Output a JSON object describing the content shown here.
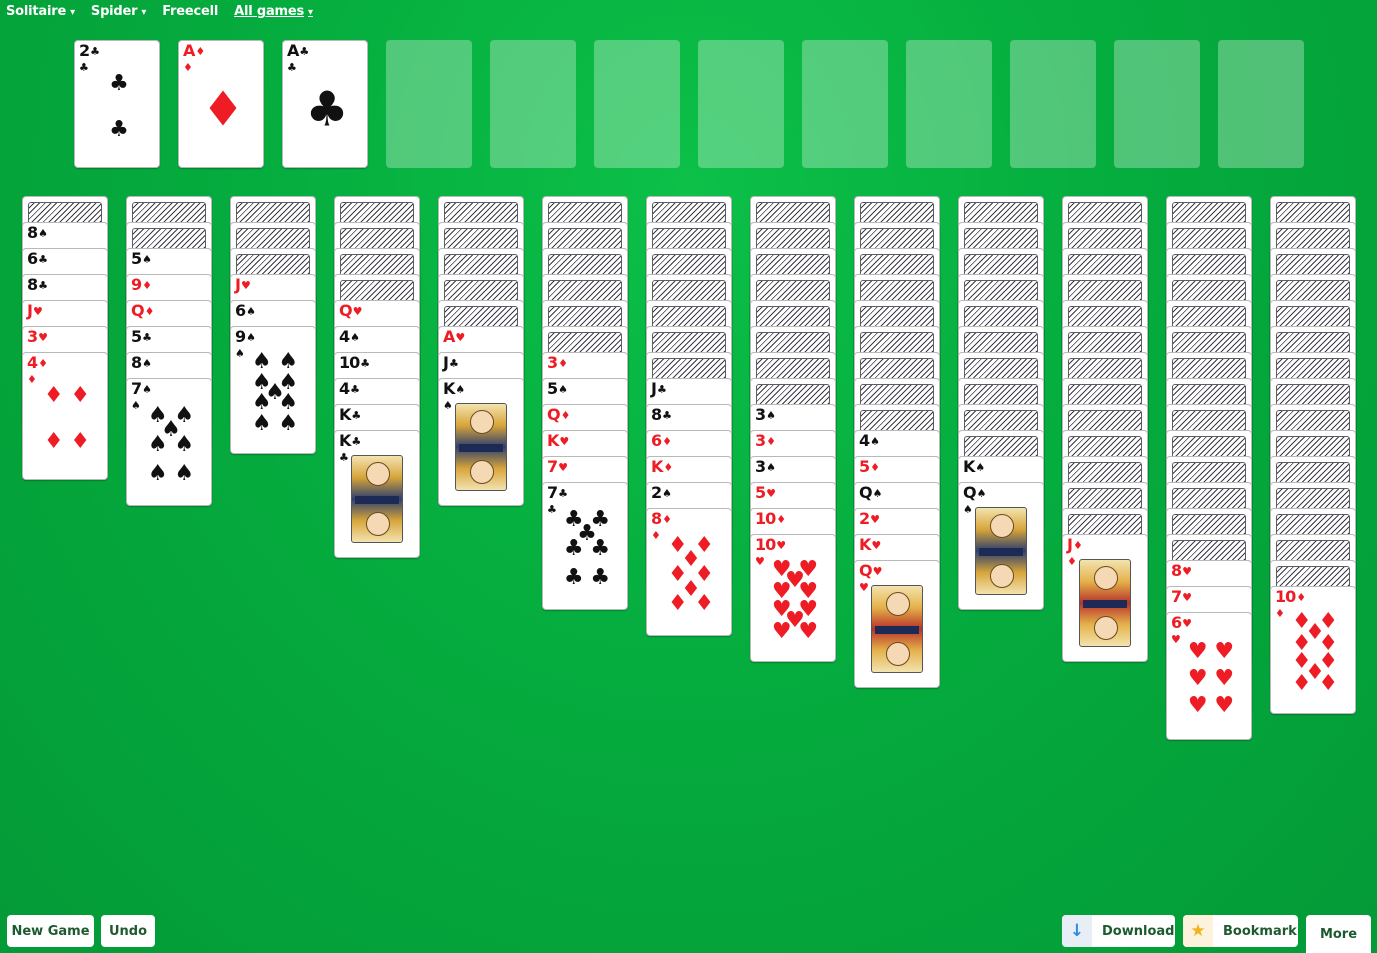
{
  "nav": [
    {
      "label": "Solitaire",
      "caret": "▾"
    },
    {
      "label": "Spider",
      "caret": "▾"
    },
    {
      "label": "Freecell",
      "caret": ""
    },
    {
      "label": "All games",
      "caret": "▾",
      "underline": true
    }
  ],
  "foundations": [
    {
      "rank": "2",
      "suit": "♣",
      "color": "black"
    },
    {
      "rank": "A",
      "suit": "♦",
      "color": "red"
    },
    {
      "rank": "A",
      "suit": "♣",
      "color": "black"
    },
    null,
    null,
    null,
    null,
    null,
    null,
    null,
    null,
    null
  ],
  "columns": [
    {
      "hidden": 1,
      "up": [
        [
          "8",
          "♠"
        ],
        [
          "6",
          "♣"
        ],
        [
          "8",
          "♣"
        ],
        [
          "J",
          "♥"
        ],
        [
          "3",
          "♥"
        ],
        [
          "4",
          "♦"
        ]
      ]
    },
    {
      "hidden": 2,
      "up": [
        [
          "5",
          "♠"
        ],
        [
          "9",
          "♦"
        ],
        [
          "Q",
          "♦"
        ],
        [
          "5",
          "♣"
        ],
        [
          "8",
          "♠"
        ],
        [
          "7",
          "♠"
        ]
      ]
    },
    {
      "hidden": 3,
      "up": [
        [
          "J",
          "♥"
        ],
        [
          "6",
          "♠"
        ],
        [
          "9",
          "♠"
        ]
      ]
    },
    {
      "hidden": 4,
      "up": [
        [
          "Q",
          "♥"
        ],
        [
          "4",
          "♠"
        ],
        [
          "10",
          "♣"
        ],
        [
          "4",
          "♣"
        ],
        [
          "K",
          "♣"
        ],
        [
          "K",
          "♣"
        ]
      ]
    },
    {
      "hidden": 5,
      "up": [
        [
          "A",
          "♥"
        ],
        [
          "J",
          "♣"
        ],
        [
          "K",
          "♠"
        ]
      ]
    },
    {
      "hidden": 6,
      "up": [
        [
          "3",
          "♦"
        ],
        [
          "5",
          "♠"
        ],
        [
          "Q",
          "♦"
        ],
        [
          "K",
          "♥"
        ],
        [
          "7",
          "♥"
        ],
        [
          "7",
          "♣"
        ]
      ]
    },
    {
      "hidden": 7,
      "up": [
        [
          "J",
          "♣"
        ],
        [
          "8",
          "♣"
        ],
        [
          "6",
          "♦"
        ],
        [
          "K",
          "♦"
        ],
        [
          "2",
          "♠"
        ],
        [
          "8",
          "♦"
        ]
      ]
    },
    {
      "hidden": 8,
      "up": [
        [
          "3",
          "♠"
        ],
        [
          "3",
          "♦"
        ],
        [
          "3",
          "♠"
        ],
        [
          "5",
          "♥"
        ],
        [
          "10",
          "♦"
        ],
        [
          "10",
          "♥"
        ]
      ]
    },
    {
      "hidden": 9,
      "up": [
        [
          "4",
          "♠"
        ],
        [
          "5",
          "♦"
        ],
        [
          "Q",
          "♠"
        ],
        [
          "2",
          "♥"
        ],
        [
          "K",
          "♥"
        ],
        [
          "Q",
          "♥"
        ]
      ]
    },
    {
      "hidden": 10,
      "up": [
        [
          "K",
          "♠"
        ],
        [
          "Q",
          "♠"
        ]
      ]
    },
    {
      "hidden": 13,
      "up": [
        [
          "J",
          "♦"
        ]
      ]
    },
    {
      "hidden": 14,
      "up": [
        [
          "8",
          "♥"
        ],
        [
          "7",
          "♥"
        ],
        [
          "6",
          "♥"
        ]
      ]
    },
    {
      "hidden": 15,
      "up": [
        [
          "10",
          "♦"
        ]
      ]
    }
  ],
  "buttons": {
    "new_game": "New Game",
    "undo": "Undo",
    "download": "Download",
    "bookmark": "Bookmark",
    "more": "More"
  },
  "colors": {
    "felt": "#05ac3e",
    "red_suit": "#ee1c24",
    "button_text": "#1d5a2f"
  }
}
